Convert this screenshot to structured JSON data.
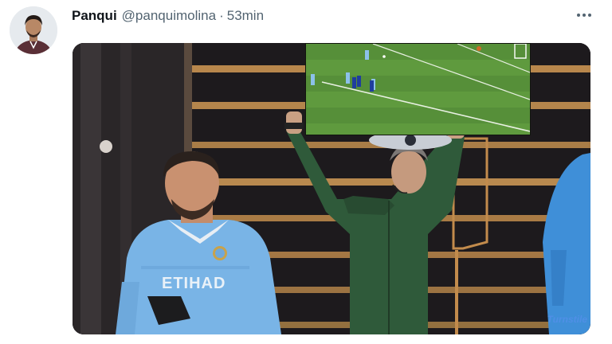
{
  "tweet": {
    "author_name": "Panqui",
    "author_handle": "@panquimolina",
    "separator": "·",
    "time": "53min",
    "more_icon": "more-horizontal-icon"
  },
  "media": {
    "watermark": "Turnstile",
    "colors": {
      "city_blue": "#79b4e6",
      "referee_green": "#2f5a3a",
      "pitch_green": "#5f9a3e",
      "stage_gold": "#b58a4a"
    }
  }
}
